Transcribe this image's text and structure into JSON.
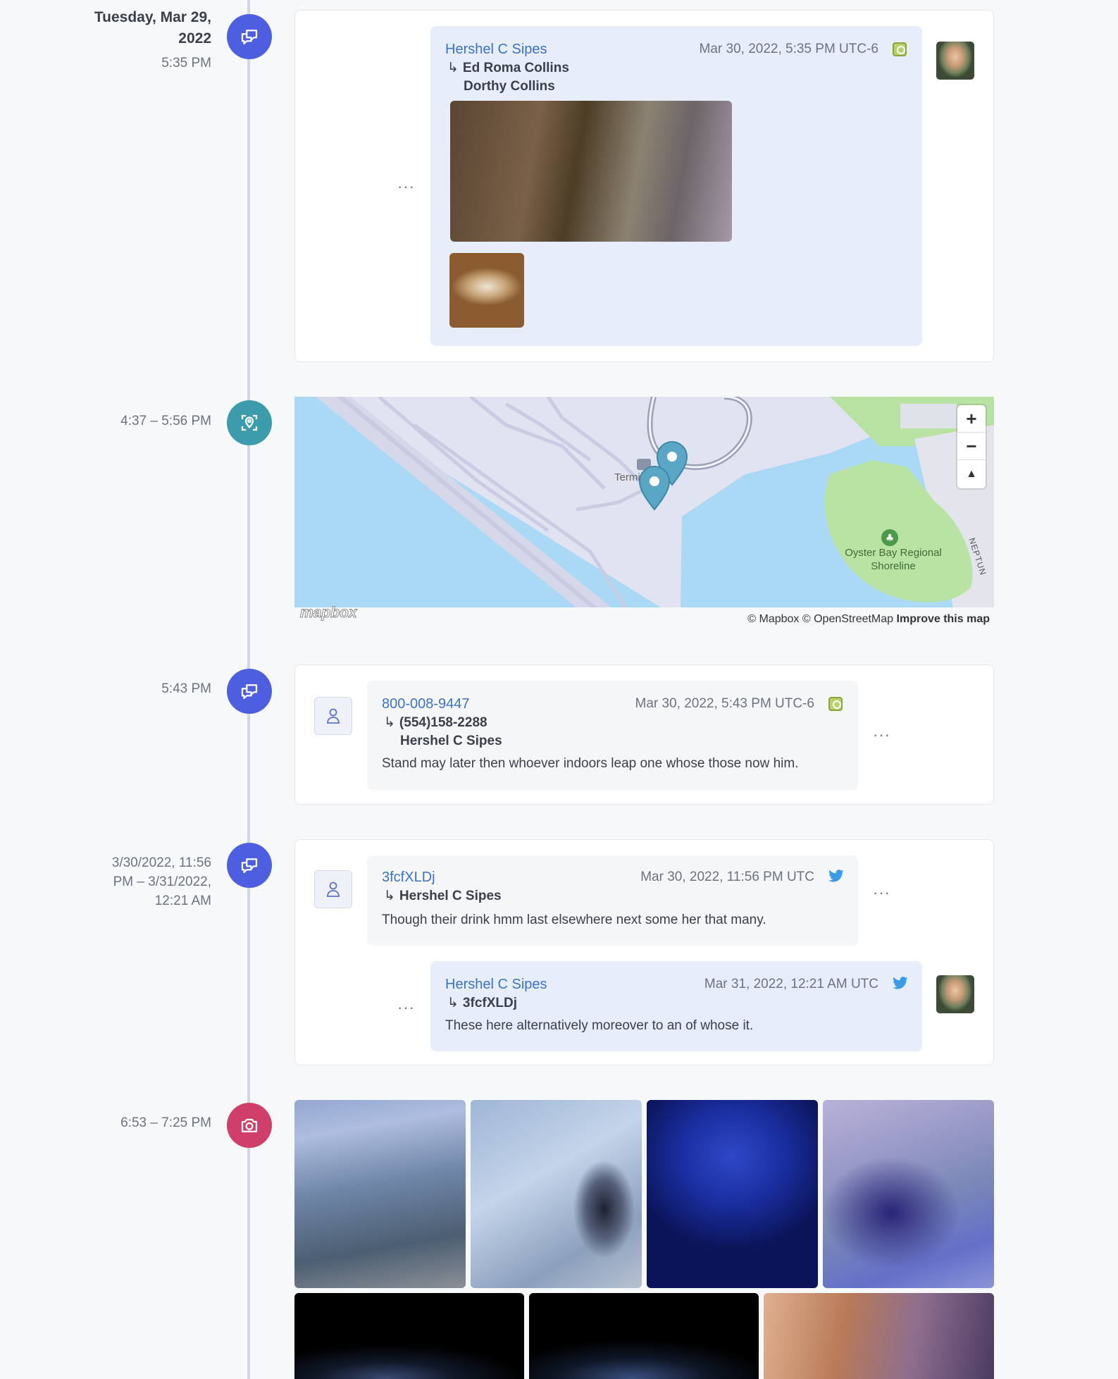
{
  "colors": {
    "message_icon": "#4d5fe0",
    "location_icon": "#3c9cab",
    "camera_icon": "#cf3f6a",
    "link": "#3b73c4"
  },
  "events": {
    "e1": {
      "date": "Tuesday, Mar 29, 2022",
      "date_line1": "Tuesday, Mar 29,",
      "date_line2": "2022",
      "time": "5:35 PM",
      "icon": "chat-icon",
      "message": {
        "from": "Hershel C Sipes",
        "timestamp": "Mar 30, 2022, 5:35 PM UTC-6",
        "to": [
          "Ed Roma Collins",
          "Dorthy Collins"
        ],
        "source_icon": "contact-icon",
        "attachments": 2
      }
    },
    "e2": {
      "time": "4:37 – 5:56 PM",
      "icon": "location-icon",
      "map": {
        "labels": {
          "terminal": "Termi",
          "park": "Oyster Bay Regional Shoreline",
          "street": "NEPTUN"
        },
        "attribution": "© Mapbox © OpenStreetMap",
        "improve": "Improve this map",
        "logo": "mapbox",
        "controls": [
          "+",
          "−",
          "compass"
        ],
        "pins": 2
      }
    },
    "e3": {
      "time": "5:43 PM",
      "icon": "chat-icon",
      "message": {
        "from": "800-008-9447",
        "timestamp": "Mar 30, 2022, 5:43 PM UTC-6",
        "to": [
          "(554)158-2288",
          "Hershel C Sipes"
        ],
        "body": "Stand may later then whoever indoors leap one whose those now him.",
        "source_icon": "contact-icon"
      }
    },
    "e4": {
      "time_line1": "3/30/2022, 11:56",
      "time_line2": "PM – 3/31/2022,",
      "time_line3": "12:21 AM",
      "icon": "chat-icon",
      "messages": [
        {
          "from": "3fcfXLDj",
          "timestamp": "Mar 30, 2022, 11:56 PM UTC",
          "to": [
            "Hershel C Sipes"
          ],
          "body": "Though their drink hmm last elsewhere next some her that many.",
          "source_icon": "twitter-icon"
        },
        {
          "from": "Hershel C Sipes",
          "timestamp": "Mar 31, 2022, 12:21 AM UTC",
          "to": [
            "3fcfXLDj"
          ],
          "body": "These here alternatively moreover to an of whose it.",
          "source_icon": "twitter-icon"
        }
      ]
    },
    "e5": {
      "time": "6:53 – 7:25 PM",
      "icon": "camera-icon",
      "photos": 7
    }
  },
  "ui": {
    "more_menu": "···"
  }
}
